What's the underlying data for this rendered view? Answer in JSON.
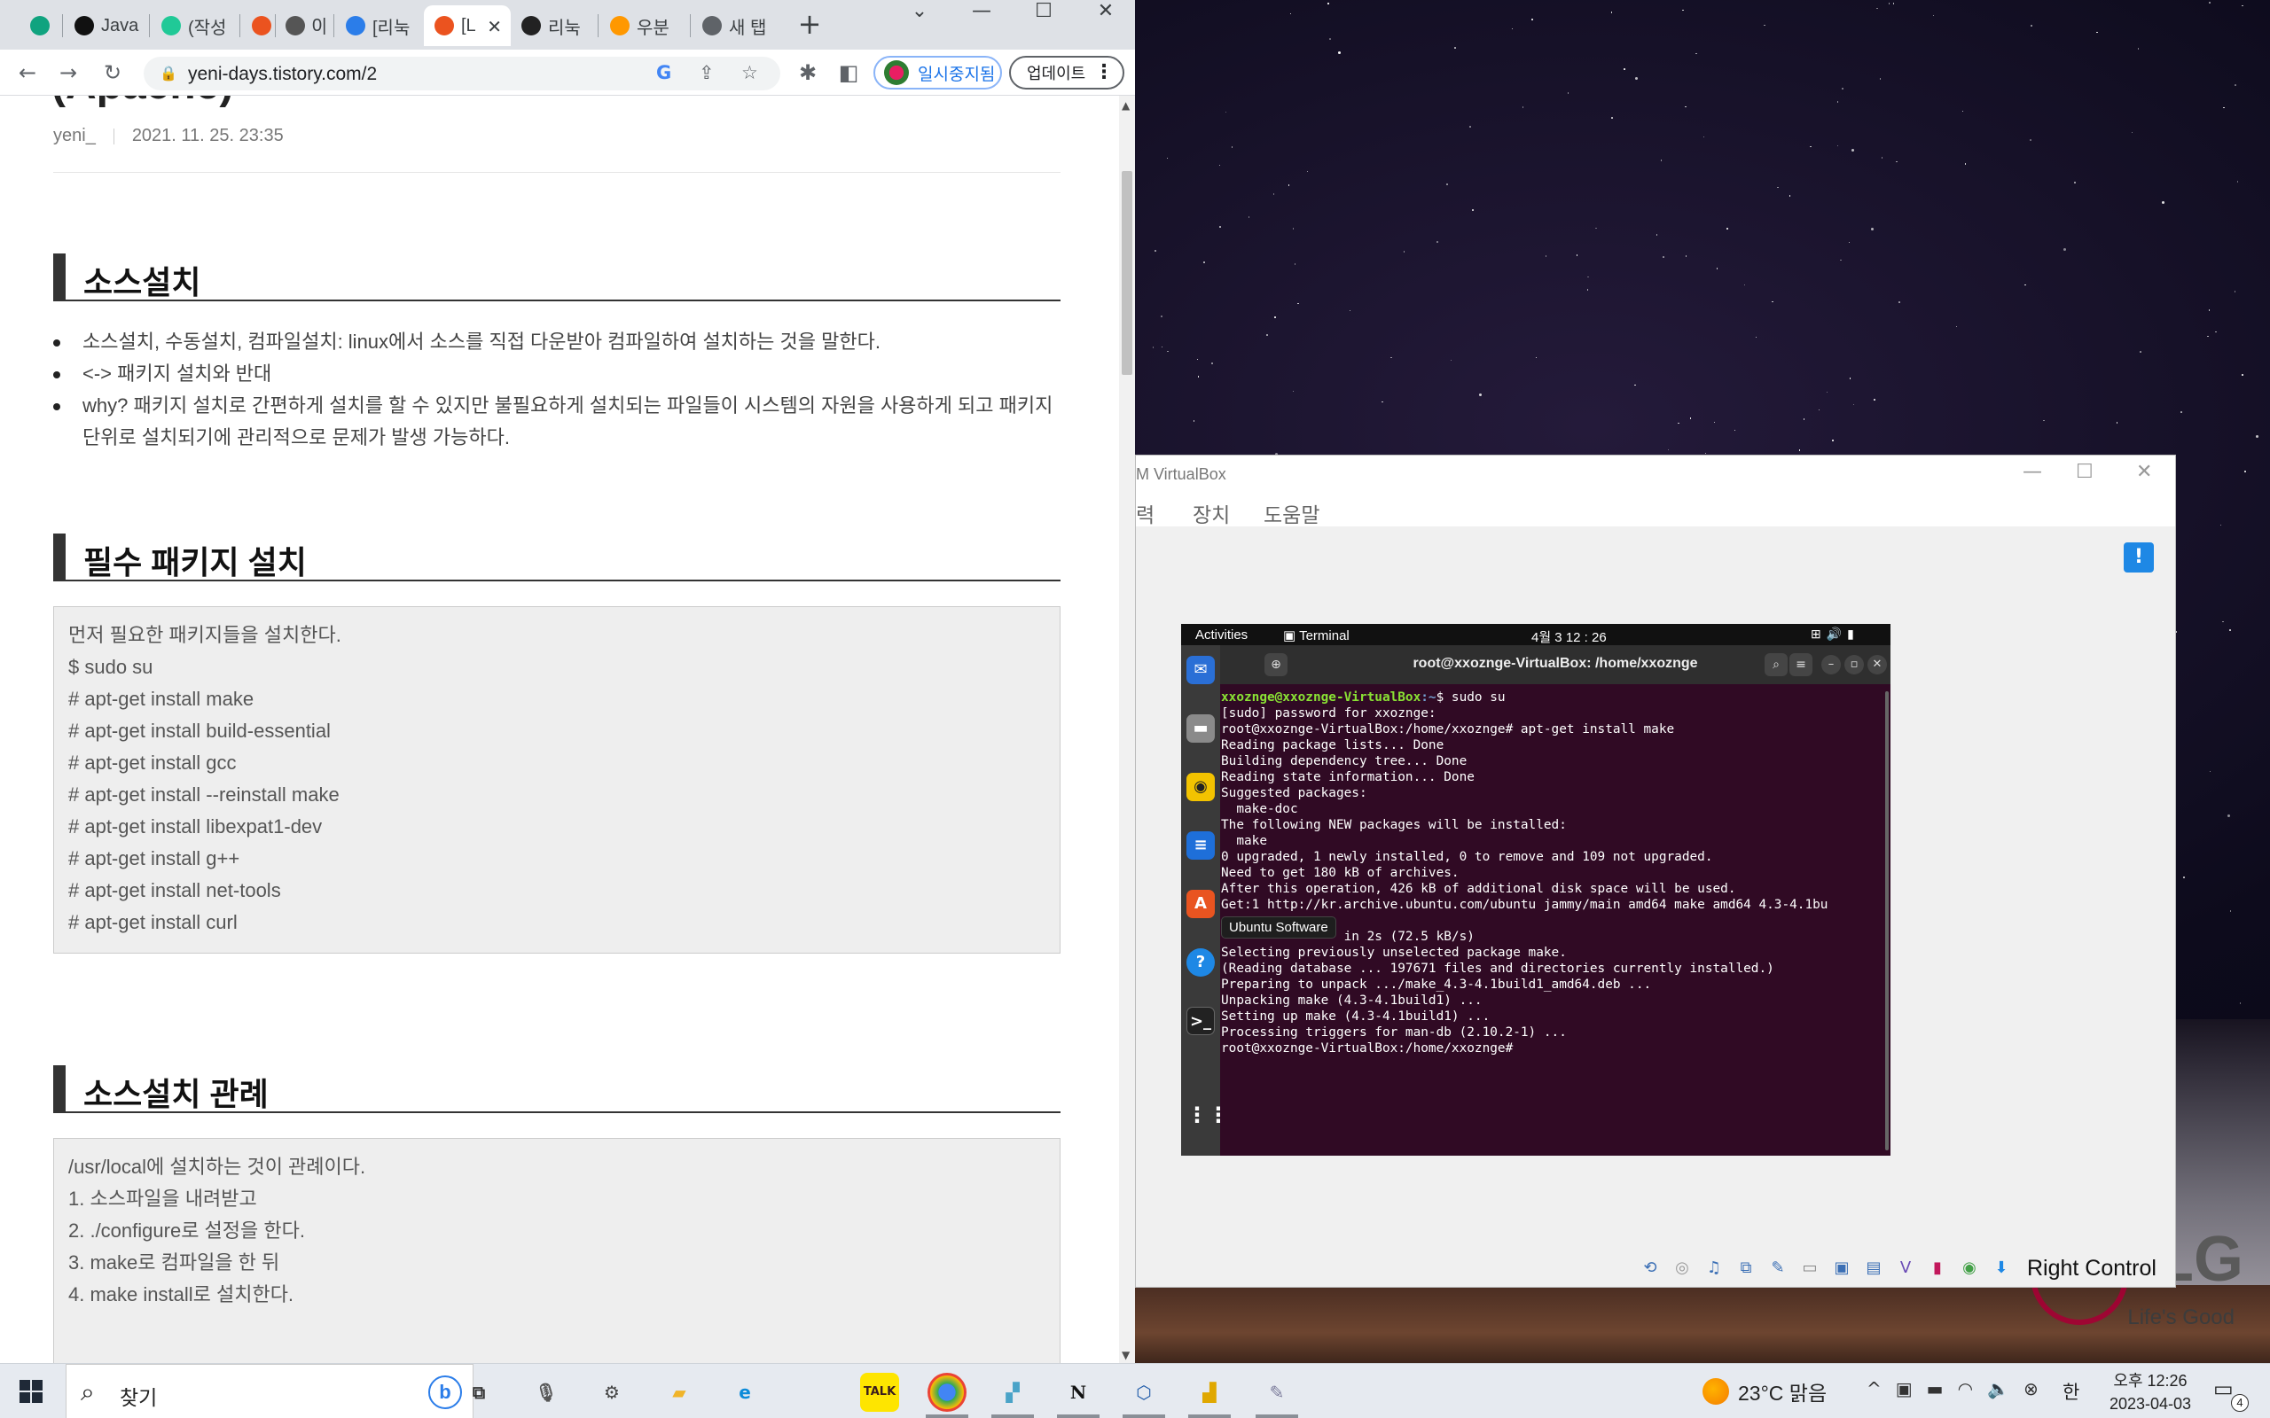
{
  "browser": {
    "tabs": [
      {
        "label": "",
        "favicon": "chatgpt-icon",
        "color": "#10a37f"
      },
      {
        "label": "Java",
        "favicon": "circle-icon",
        "color": "#111111"
      },
      {
        "label": "(작성",
        "favicon": "velog-icon",
        "color": "#20c997"
      },
      {
        "label": "",
        "favicon": "tistory-icon",
        "color": "#eb531f"
      },
      {
        "label": "0|",
        "favicon": "rocket-icon",
        "color": "#555555"
      },
      {
        "label": "[리눅",
        "favicon": "bing-icon",
        "color": "#2b7de9"
      },
      {
        "label": "[L",
        "favicon": "tistory-icon",
        "color": "#eb531f",
        "active": true
      },
      {
        "label": "리눅",
        "favicon": "terminal-icon",
        "color": "#222222"
      },
      {
        "label": "우분",
        "favicon": "color-icon",
        "color": "#ff9800"
      },
      {
        "label": "새 탭",
        "favicon": "chrome-icon",
        "color": "#5f6368"
      }
    ],
    "url": "yeni-days.tistory.com/2",
    "profile_label": "일시중지됨",
    "update_label": "업데이트"
  },
  "post": {
    "title_partial": "(Apache)",
    "author": "yeni_",
    "date": "2021. 11. 25. 23:35",
    "sections": [
      {
        "heading": "소스설치",
        "bullets": [
          "소스설치, 수동설치, 컴파일설치: linux에서 소스를 직접 다운받아 컴파일하여 설치하는 것을 말한다.",
          "<-> 패키지 설치와 반대",
          "why? 패키지 설치로 간편하게 설치를 할 수 있지만 불필요하게 설치되는 파일들이 시스템의 자원을 사용하게 되고 패키지 단위로 설치되기에 관리적으로 문제가 발생 가능하다."
        ]
      },
      {
        "heading": "필수 패키지 설치",
        "code": [
          "먼저 필요한 패키지들을 설치한다.",
          "$ sudo su",
          "# apt-get install make",
          "# apt-get install build-essential",
          "# apt-get install gcc",
          "# apt-get install --reinstall make",
          "# apt-get install libexpat1-dev",
          "# apt-get install g++",
          "# apt-get install net-tools",
          "# apt-get install curl"
        ]
      },
      {
        "heading": "소스설치 관례",
        "code": [
          "/usr/local에 설치하는 것이 관례이다.",
          "1. 소스파일을 내려받고",
          "2. ./configure로 설정을 한다.",
          "3. make로 컴파일을 한 뒤",
          "4. make install로 설치한다."
        ]
      }
    ]
  },
  "vbox": {
    "title": "M VirtualBox",
    "menu": [
      "력",
      "장치",
      "도움말"
    ],
    "host_key": "Right Control"
  },
  "guest": {
    "activities": "Activities",
    "app_name": "Terminal",
    "clock": "4월 3  12 : 26",
    "tooltip": "Ubuntu Software",
    "terminal_title": "root@xxoznge-VirtualBox: /home/xxoznge",
    "prompt_user": "xxoznge@xxoznge-VirtualBox",
    "prompt_path": ":~",
    "first_command": "$ sudo su",
    "lines": [
      "[sudo] password for xxoznge:",
      "root@xxoznge-VirtualBox:/home/xxoznge# apt-get install make",
      "Reading package lists... Done",
      "Building dependency tree... Done",
      "Reading state information... Done",
      "Suggested packages:",
      "  make-doc",
      "The following NEW packages will be installed:",
      "  make",
      "0 upgraded, 1 newly installed, 0 to remove and 109 not upgraded.",
      "Need to get 180 kB of archives.",
      "After this operation, 426 kB of additional disk space will be used.",
      "Get:1 http://kr.archive.ubuntu.com/ubuntu jammy/main amd64 make amd64 4.3-4.1bu",
      "",
      "                in 2s (72.5 kB/s)",
      "Selecting previously unselected package make.",
      "(Reading database ... 197671 files and directories currently installed.)",
      "Preparing to unpack .../make_4.3-4.1build1_amd64.deb ...",
      "Unpacking make (4.3-4.1build1) ...",
      "Setting up make (4.3-4.1build1) ...",
      "Processing triggers for man-db (2.10.2-1) ...",
      "root@xxoznge-VirtualBox:/home/xxoznge#"
    ]
  },
  "wallpaper": {
    "brand": "LG",
    "slogan": "Life's Good"
  },
  "taskbar": {
    "search_placeholder": "찾기",
    "weather": "23°C  맑음",
    "ime": "한",
    "time": "오후 12:26",
    "date": "2023-04-03",
    "notification_count": "4"
  }
}
